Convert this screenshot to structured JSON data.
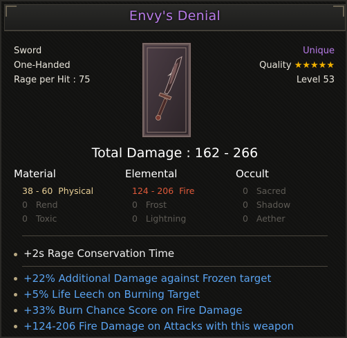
{
  "item": {
    "name": "Envy's Denial",
    "rarity": "Unique",
    "type": "Sword",
    "handedness": "One-Handed",
    "rage_per_hit": "Rage per Hit : 75",
    "quality_label": "Quality",
    "quality_stars": 5,
    "stars_text": "★★★★★",
    "level": "Level 53",
    "icon": "sword-art"
  },
  "total_damage": "Total Damage : 162 - 266",
  "damage_columns": [
    {
      "header": "Material",
      "rows": [
        {
          "value": "38 - 60",
          "label": "Physical"
        },
        {
          "value": "0",
          "label": "Rend"
        },
        {
          "value": "0",
          "label": "Toxic"
        }
      ]
    },
    {
      "header": "Elemental",
      "rows": [
        {
          "value": "124 - 206",
          "label": "Fire"
        },
        {
          "value": "0",
          "label": "Frost"
        },
        {
          "value": "0",
          "label": "Lightning"
        }
      ]
    },
    {
      "header": "Occult",
      "rows": [
        {
          "value": "0",
          "label": "Sacred"
        },
        {
          "value": "0",
          "label": "Shadow"
        },
        {
          "value": "0",
          "label": "Aether"
        }
      ]
    }
  ],
  "implicit": "+2s Rage Conservation Time",
  "affixes": [
    "+22% Additional Damage against Frozen target",
    "+5% Life Leech on Burning Target",
    "+33% Burn Chance Score on Fire Damage",
    "+124-206 Fire Damage on Attacks with this weapon"
  ],
  "colors": {
    "unique": "#b87be8",
    "physical": "#e8cf96",
    "fire": "#e05a3a",
    "affix": "#5aa3f0",
    "inactive": "#5e5b55",
    "stars": "#f2b200"
  }
}
